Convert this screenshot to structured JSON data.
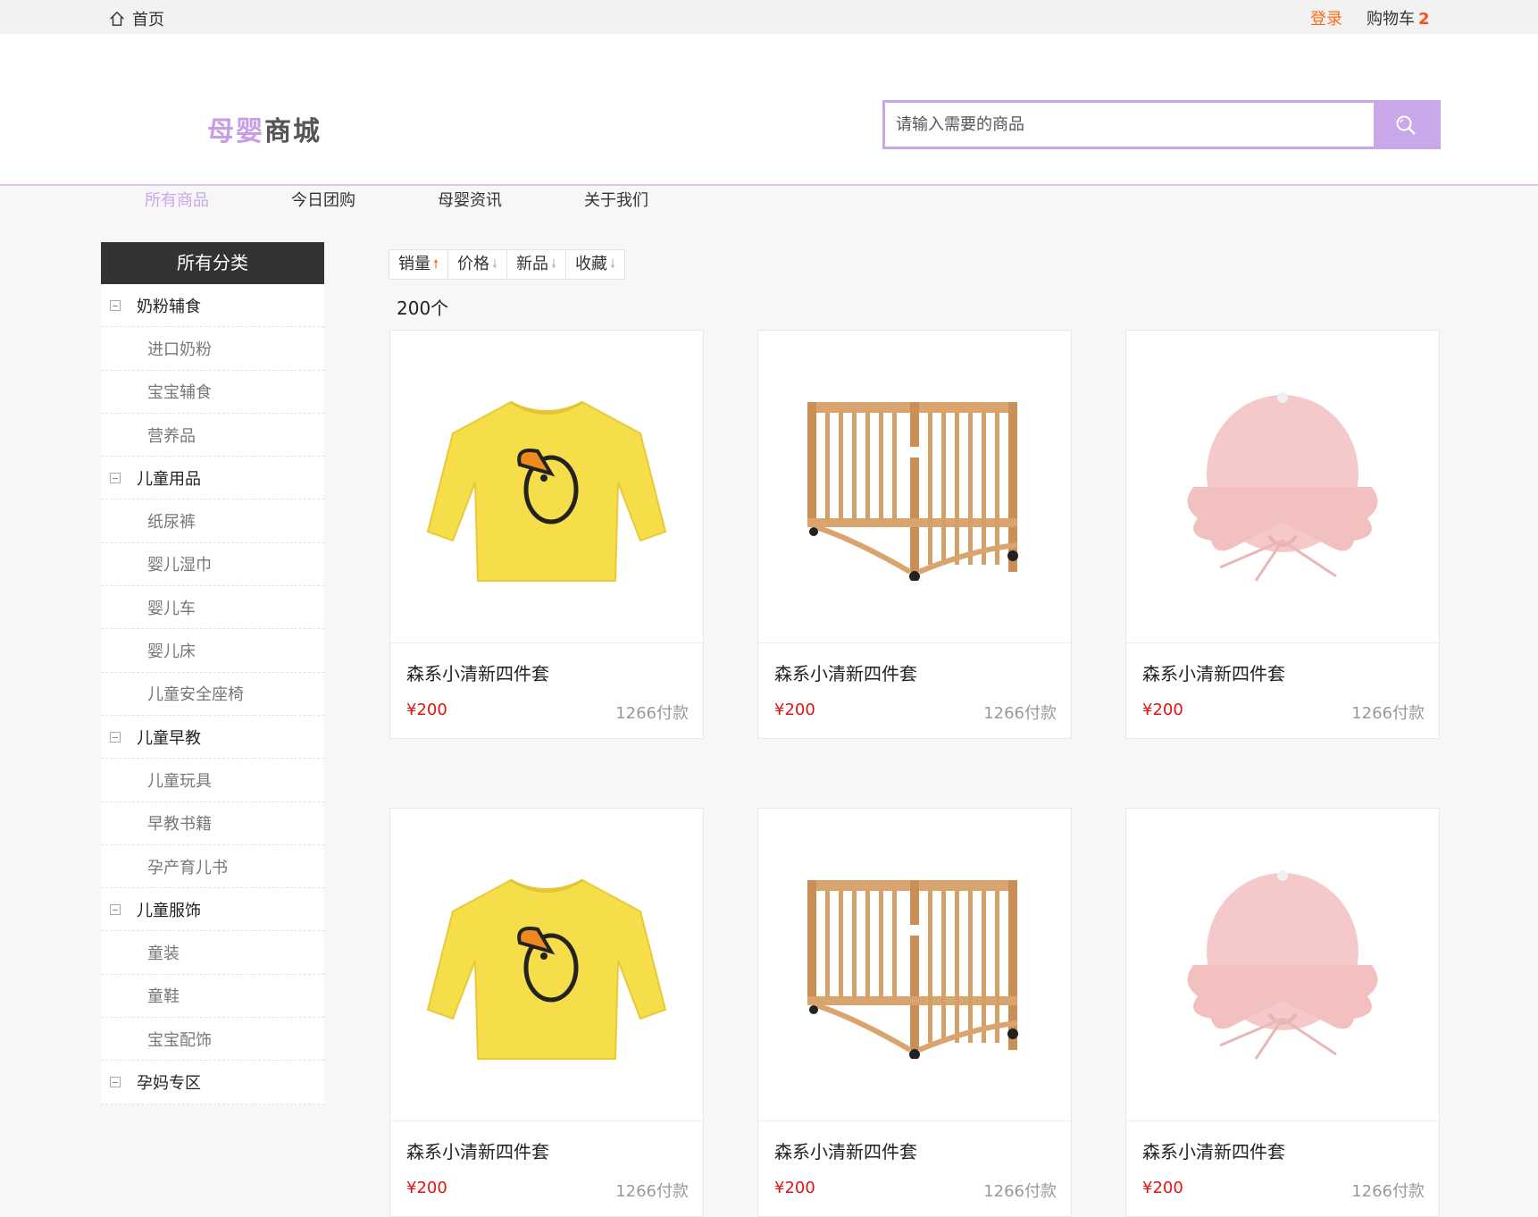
{
  "topbar": {
    "home": "首页",
    "login": "登录",
    "cart_label": "购物车",
    "cart_count": "2"
  },
  "logo": {
    "part1": "母婴",
    "part2": "商城"
  },
  "search": {
    "placeholder": "请输入需要的商品"
  },
  "nav": [
    "所有商品",
    "今日团购",
    "母婴资讯",
    "关于我们"
  ],
  "sidebar": {
    "title": "所有分类",
    "items": [
      {
        "label": "奶粉辅食",
        "level": 1
      },
      {
        "label": "进口奶粉",
        "level": 2
      },
      {
        "label": "宝宝辅食",
        "level": 2
      },
      {
        "label": "营养品",
        "level": 2
      },
      {
        "label": "儿童用品",
        "level": 1
      },
      {
        "label": "纸尿裤",
        "level": 2
      },
      {
        "label": "婴儿湿巾",
        "level": 2
      },
      {
        "label": "婴儿车",
        "level": 2
      },
      {
        "label": "婴儿床",
        "level": 2
      },
      {
        "label": "儿童安全座椅",
        "level": 2
      },
      {
        "label": "儿童早教",
        "level": 1
      },
      {
        "label": "儿童玩具",
        "level": 2
      },
      {
        "label": "早教书籍",
        "level": 2
      },
      {
        "label": "孕产育儿书",
        "level": 2
      },
      {
        "label": "儿童服饰",
        "level": 1
      },
      {
        "label": "童装",
        "level": 2
      },
      {
        "label": "童鞋",
        "level": 2
      },
      {
        "label": "宝宝配饰",
        "level": 2
      },
      {
        "label": "孕妈专区",
        "level": 1
      }
    ]
  },
  "sort": {
    "sales": "销量",
    "price": "价格",
    "new": "新品",
    "fav": "收藏"
  },
  "result_count": "200个",
  "products": [
    {
      "title": "森系小清新四件套",
      "price": "¥200",
      "sales": "1266付款",
      "image": "yellow-shirt"
    },
    {
      "title": "森系小清新四件套",
      "price": "¥200",
      "sales": "1266付款",
      "image": "crib"
    },
    {
      "title": "森系小清新四件套",
      "price": "¥200",
      "sales": "1266付款",
      "image": "pink-hat"
    },
    {
      "title": "森系小清新四件套",
      "price": "¥200",
      "sales": "1266付款",
      "image": "yellow-shirt"
    },
    {
      "title": "森系小清新四件套",
      "price": "¥200",
      "sales": "1266付款",
      "image": "crib"
    },
    {
      "title": "森系小清新四件套",
      "price": "¥200",
      "sales": "1266付款",
      "image": "pink-hat"
    }
  ]
}
